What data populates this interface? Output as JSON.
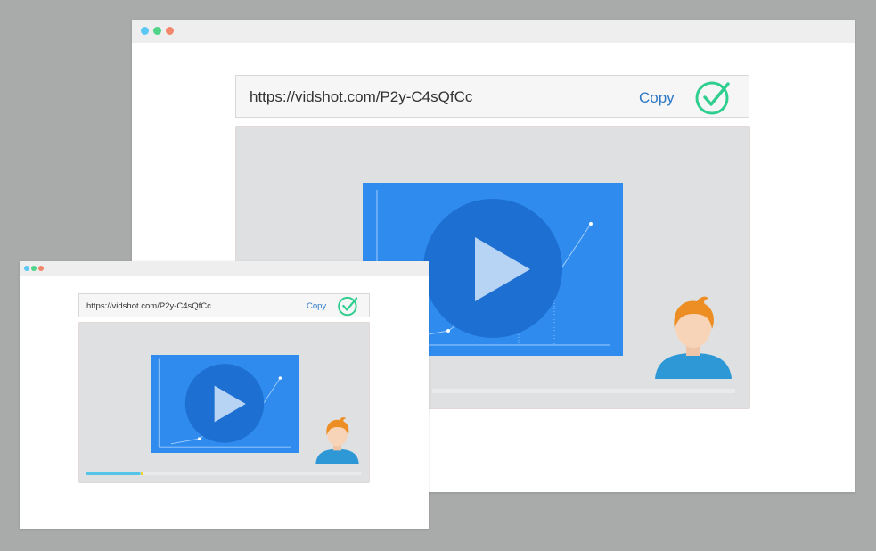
{
  "large_window": {
    "traffic_lights": [
      "#5bc7f5",
      "#4fd48a",
      "#f2876b"
    ],
    "url": "https://vidshot.com/P2y-C4sQfCc",
    "copy_label": "Copy",
    "check_icon": "check-circle-icon",
    "play_icon": "play-icon",
    "presenter_icon": "avatar-icon"
  },
  "small_window": {
    "traffic_lights": [
      "#5bc7f5",
      "#4fd48a",
      "#f2876b"
    ],
    "url": "https://vidshot.com/P2y-C4sQfCc",
    "copy_label": "Copy",
    "check_icon": "check-circle-icon",
    "play_icon": "play-icon",
    "presenter_icon": "avatar-icon",
    "progress": 0.2
  },
  "colors": {
    "accent_blue": "#2f8cee",
    "check_green": "#2fce8f",
    "copy_blue": "#2a78c6",
    "progress_cyan": "#54c5e6"
  }
}
